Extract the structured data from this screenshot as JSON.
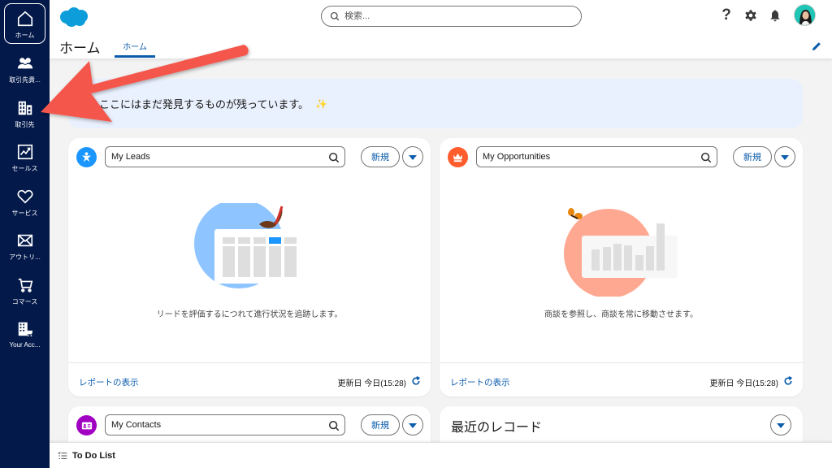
{
  "sidebar": {
    "items": [
      {
        "label": "ホーム",
        "icon": "home-icon",
        "active": true
      },
      {
        "label": "取引先責...",
        "icon": "contacts-group-icon"
      },
      {
        "label": "取引先",
        "icon": "building-icon"
      },
      {
        "label": "セールス",
        "icon": "sales-chart-icon"
      },
      {
        "label": "サービス",
        "icon": "heart-icon"
      },
      {
        "label": "アウトリ...",
        "icon": "envelope-icon"
      },
      {
        "label": "コマース",
        "icon": "cart-icon"
      },
      {
        "label": "Your Acc...",
        "icon": "store-building-icon"
      }
    ]
  },
  "header": {
    "search_placeholder": "検索...",
    "help_label": "?",
    "app_title": "ホーム",
    "tab_label": "ホーム"
  },
  "banner": {
    "text": "ここにはまだ発見するものが残っています。",
    "emoji": "✨"
  },
  "cards": {
    "leads": {
      "list_name": "My Leads",
      "new_label": "新規",
      "empty_text": "リードを評価するにつれて進行状況を追跡します。",
      "report_link": "レポートの表示",
      "updated": "更新日 今日(15:28)",
      "icon_color": "#1b96ff"
    },
    "opportunities": {
      "list_name": "My Opportunities",
      "new_label": "新規",
      "empty_text": "商談を参照し、商談を常に移動させます。",
      "report_link": "レポートの表示",
      "updated": "更新日 今日(15:28)",
      "icon_color": "#ff5d2d"
    },
    "contacts": {
      "list_name": "My Contacts",
      "new_label": "新規",
      "icon_color": "#a100c2"
    },
    "recent": {
      "title": "最近のレコード"
    }
  },
  "utility_bar": {
    "todo_label": "To Do List"
  },
  "colors": {
    "sidebar_bg": "#03194a",
    "brand_blue": "#0b5cab",
    "annotation_arrow": "#f4574b"
  }
}
